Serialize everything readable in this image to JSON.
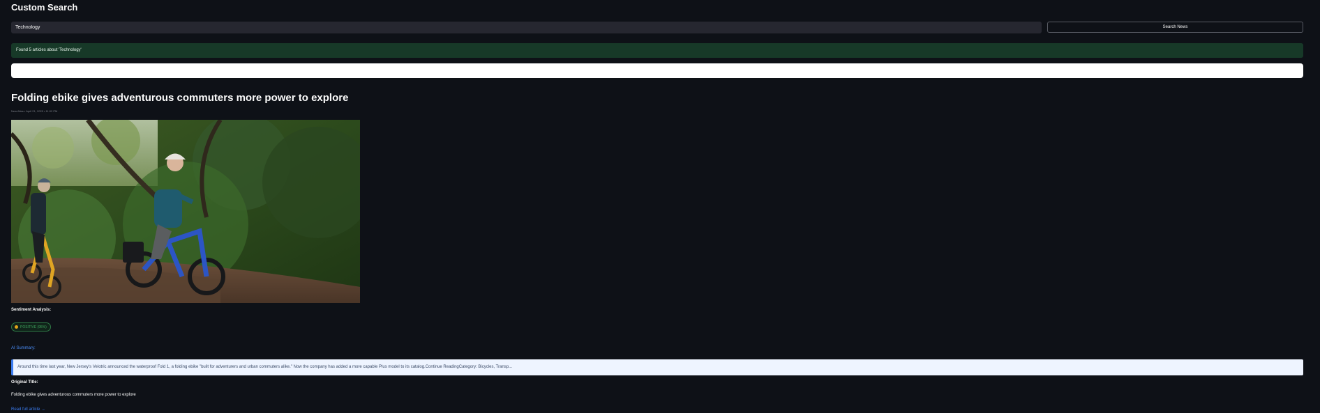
{
  "page": {
    "title": "Custom Search"
  },
  "search": {
    "query": "Technology",
    "button_label": "Search News"
  },
  "status": {
    "message": "Found 5 articles about 'Technology'"
  },
  "article": {
    "title": "Folding ebike gives adventurous commuters more power to explore",
    "meta": "New Atlas • April 21, 2025 • 11:02 PM",
    "image_alt": "Two riders on folding ebikes on a dirt trail in the woods",
    "sentiment_label": "Sentiment Analysis:",
    "sentiment_value": "POSITIVE (95%)",
    "ai_summary_label": "AI Summary:",
    "summary": "Around this time last year, New Jersey's Velotric announced the waterproof Fold 1, a folding ebike \"built for adventurers and urban commuters alike.\" Now the company has added a more capable Plus model to its catalog.Continue ReadingCategory: Bicycles, Transp...",
    "original_title_label": "Original Title:",
    "original_title": "Folding ebike gives adventurous commuters more power to explore",
    "read_more": "Read full article →"
  },
  "colors": {
    "background": "#0e1117",
    "success_bg": "#173928",
    "accent_blue": "#3b7cf0",
    "positive_green": "#3fa35e"
  }
}
